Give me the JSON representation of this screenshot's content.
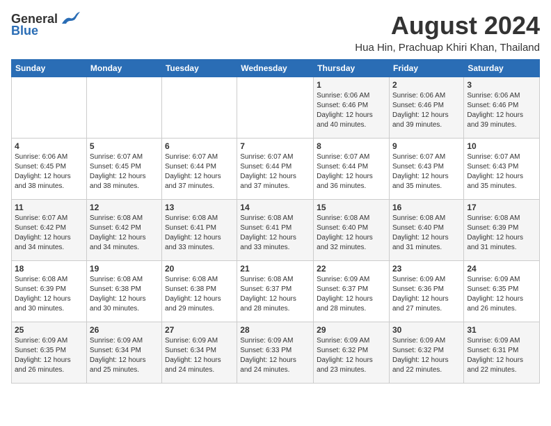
{
  "header": {
    "logo_general": "General",
    "logo_blue": "Blue",
    "title": "August 2024",
    "subtitle": "Hua Hin, Prachuap Khiri Khan, Thailand"
  },
  "days_of_week": [
    "Sunday",
    "Monday",
    "Tuesday",
    "Wednesday",
    "Thursday",
    "Friday",
    "Saturday"
  ],
  "weeks": [
    [
      {
        "day": "",
        "info": ""
      },
      {
        "day": "",
        "info": ""
      },
      {
        "day": "",
        "info": ""
      },
      {
        "day": "",
        "info": ""
      },
      {
        "day": "1",
        "info": "Sunrise: 6:06 AM\nSunset: 6:46 PM\nDaylight: 12 hours\nand 40 minutes."
      },
      {
        "day": "2",
        "info": "Sunrise: 6:06 AM\nSunset: 6:46 PM\nDaylight: 12 hours\nand 39 minutes."
      },
      {
        "day": "3",
        "info": "Sunrise: 6:06 AM\nSunset: 6:46 PM\nDaylight: 12 hours\nand 39 minutes."
      }
    ],
    [
      {
        "day": "4",
        "info": "Sunrise: 6:06 AM\nSunset: 6:45 PM\nDaylight: 12 hours\nand 38 minutes."
      },
      {
        "day": "5",
        "info": "Sunrise: 6:07 AM\nSunset: 6:45 PM\nDaylight: 12 hours\nand 38 minutes."
      },
      {
        "day": "6",
        "info": "Sunrise: 6:07 AM\nSunset: 6:44 PM\nDaylight: 12 hours\nand 37 minutes."
      },
      {
        "day": "7",
        "info": "Sunrise: 6:07 AM\nSunset: 6:44 PM\nDaylight: 12 hours\nand 37 minutes."
      },
      {
        "day": "8",
        "info": "Sunrise: 6:07 AM\nSunset: 6:44 PM\nDaylight: 12 hours\nand 36 minutes."
      },
      {
        "day": "9",
        "info": "Sunrise: 6:07 AM\nSunset: 6:43 PM\nDaylight: 12 hours\nand 35 minutes."
      },
      {
        "day": "10",
        "info": "Sunrise: 6:07 AM\nSunset: 6:43 PM\nDaylight: 12 hours\nand 35 minutes."
      }
    ],
    [
      {
        "day": "11",
        "info": "Sunrise: 6:07 AM\nSunset: 6:42 PM\nDaylight: 12 hours\nand 34 minutes."
      },
      {
        "day": "12",
        "info": "Sunrise: 6:08 AM\nSunset: 6:42 PM\nDaylight: 12 hours\nand 34 minutes."
      },
      {
        "day": "13",
        "info": "Sunrise: 6:08 AM\nSunset: 6:41 PM\nDaylight: 12 hours\nand 33 minutes."
      },
      {
        "day": "14",
        "info": "Sunrise: 6:08 AM\nSunset: 6:41 PM\nDaylight: 12 hours\nand 33 minutes."
      },
      {
        "day": "15",
        "info": "Sunrise: 6:08 AM\nSunset: 6:40 PM\nDaylight: 12 hours\nand 32 minutes."
      },
      {
        "day": "16",
        "info": "Sunrise: 6:08 AM\nSunset: 6:40 PM\nDaylight: 12 hours\nand 31 minutes."
      },
      {
        "day": "17",
        "info": "Sunrise: 6:08 AM\nSunset: 6:39 PM\nDaylight: 12 hours\nand 31 minutes."
      }
    ],
    [
      {
        "day": "18",
        "info": "Sunrise: 6:08 AM\nSunset: 6:39 PM\nDaylight: 12 hours\nand 30 minutes."
      },
      {
        "day": "19",
        "info": "Sunrise: 6:08 AM\nSunset: 6:38 PM\nDaylight: 12 hours\nand 30 minutes."
      },
      {
        "day": "20",
        "info": "Sunrise: 6:08 AM\nSunset: 6:38 PM\nDaylight: 12 hours\nand 29 minutes."
      },
      {
        "day": "21",
        "info": "Sunrise: 6:08 AM\nSunset: 6:37 PM\nDaylight: 12 hours\nand 28 minutes."
      },
      {
        "day": "22",
        "info": "Sunrise: 6:09 AM\nSunset: 6:37 PM\nDaylight: 12 hours\nand 28 minutes."
      },
      {
        "day": "23",
        "info": "Sunrise: 6:09 AM\nSunset: 6:36 PM\nDaylight: 12 hours\nand 27 minutes."
      },
      {
        "day": "24",
        "info": "Sunrise: 6:09 AM\nSunset: 6:35 PM\nDaylight: 12 hours\nand 26 minutes."
      }
    ],
    [
      {
        "day": "25",
        "info": "Sunrise: 6:09 AM\nSunset: 6:35 PM\nDaylight: 12 hours\nand 26 minutes."
      },
      {
        "day": "26",
        "info": "Sunrise: 6:09 AM\nSunset: 6:34 PM\nDaylight: 12 hours\nand 25 minutes."
      },
      {
        "day": "27",
        "info": "Sunrise: 6:09 AM\nSunset: 6:34 PM\nDaylight: 12 hours\nand 24 minutes."
      },
      {
        "day": "28",
        "info": "Sunrise: 6:09 AM\nSunset: 6:33 PM\nDaylight: 12 hours\nand 24 minutes."
      },
      {
        "day": "29",
        "info": "Sunrise: 6:09 AM\nSunset: 6:32 PM\nDaylight: 12 hours\nand 23 minutes."
      },
      {
        "day": "30",
        "info": "Sunrise: 6:09 AM\nSunset: 6:32 PM\nDaylight: 12 hours\nand 22 minutes."
      },
      {
        "day": "31",
        "info": "Sunrise: 6:09 AM\nSunset: 6:31 PM\nDaylight: 12 hours\nand 22 minutes."
      }
    ]
  ]
}
